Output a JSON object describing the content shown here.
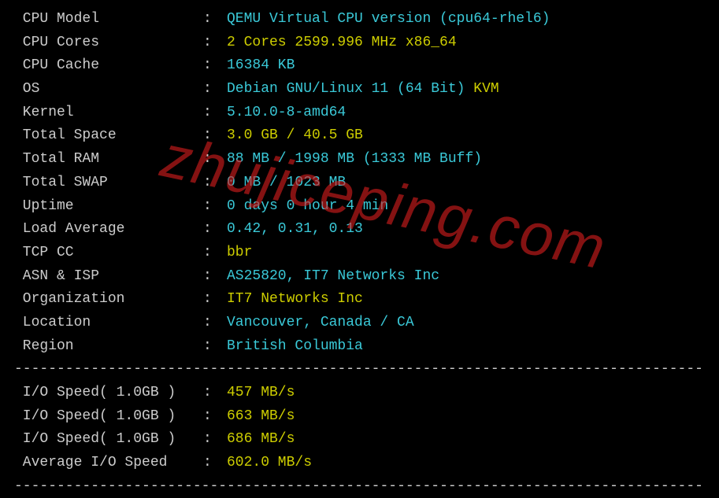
{
  "rows": [
    {
      "label": "CPU Model",
      "segments": [
        {
          "text": "QEMU Virtual CPU version (cpu64-rhel6)",
          "class": "cyan"
        }
      ]
    },
    {
      "label": "CPU Cores",
      "segments": [
        {
          "text": "2 Cores 2599.996 MHz x86_64",
          "class": "yellow"
        }
      ]
    },
    {
      "label": "CPU Cache",
      "segments": [
        {
          "text": "16384 KB",
          "class": "cyan"
        }
      ]
    },
    {
      "label": "OS",
      "segments": [
        {
          "text": "Debian GNU/Linux 11 (64 Bit) ",
          "class": "cyan"
        },
        {
          "text": "KVM",
          "class": "yellow"
        }
      ]
    },
    {
      "label": "Kernel",
      "segments": [
        {
          "text": "5.10.0-8-amd64",
          "class": "cyan"
        }
      ]
    },
    {
      "label": "Total Space",
      "segments": [
        {
          "text": "3.0 GB / 40.5 GB",
          "class": "yellow"
        }
      ]
    },
    {
      "label": "Total RAM",
      "segments": [
        {
          "text": "88 MB / 1998 MB (1333 MB Buff)",
          "class": "cyan"
        }
      ]
    },
    {
      "label": "Total SWAP",
      "segments": [
        {
          "text": "0 MB / 1023 MB",
          "class": "cyan"
        }
      ]
    },
    {
      "label": "Uptime",
      "segments": [
        {
          "text": "0 days 0 hour 4 min",
          "class": "cyan"
        }
      ]
    },
    {
      "label": "Load Average",
      "segments": [
        {
          "text": "0.42, 0.31, 0.13",
          "class": "cyan"
        }
      ]
    },
    {
      "label": "TCP CC",
      "segments": [
        {
          "text": "bbr",
          "class": "yellow"
        }
      ]
    },
    {
      "label": "ASN & ISP",
      "segments": [
        {
          "text": "AS25820, IT7 Networks Inc",
          "class": "cyan"
        }
      ]
    },
    {
      "label": "Organization",
      "segments": [
        {
          "text": "IT7 Networks Inc",
          "class": "yellow"
        }
      ]
    },
    {
      "label": "Location",
      "segments": [
        {
          "text": "Vancouver, Canada / CA",
          "class": "cyan"
        }
      ]
    },
    {
      "label": "Region",
      "segments": [
        {
          "text": "British Columbia",
          "class": "cyan"
        }
      ]
    }
  ],
  "io_rows": [
    {
      "label": "I/O Speed( 1.0GB )",
      "segments": [
        {
          "text": "457 MB/s",
          "class": "yellow"
        }
      ]
    },
    {
      "label": "I/O Speed( 1.0GB )",
      "segments": [
        {
          "text": "663 MB/s",
          "class": "yellow"
        }
      ]
    },
    {
      "label": "I/O Speed( 1.0GB )",
      "segments": [
        {
          "text": "686 MB/s",
          "class": "yellow"
        }
      ]
    },
    {
      "label": "Average I/O Speed",
      "segments": [
        {
          "text": "602.0 MB/s",
          "class": "yellow"
        }
      ]
    }
  ],
  "divider": "----------------------------------------------------------------------------------",
  "watermark": "zhujiceping.com"
}
